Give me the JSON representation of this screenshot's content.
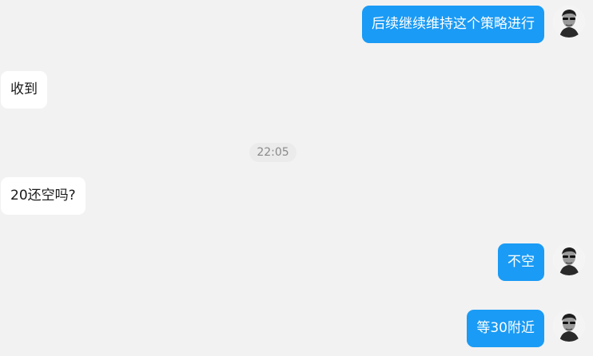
{
  "messages": [
    {
      "direction": "outgoing",
      "text": "后续继续维持这个策略进行"
    },
    {
      "direction": "incoming",
      "text": "收到"
    },
    {
      "direction": "incoming",
      "text": "20还空吗?"
    },
    {
      "direction": "outgoing",
      "text": "不空"
    },
    {
      "direction": "outgoing",
      "text": "等30附近"
    }
  ],
  "timestamp": "22:05",
  "colors": {
    "background": "#f2f2f2",
    "outgoing_bubble": "#1a9bf5",
    "incoming_bubble": "#ffffff",
    "timestamp_pill": "#ebebeb"
  },
  "avatar_icon": "user-avatar-photo"
}
